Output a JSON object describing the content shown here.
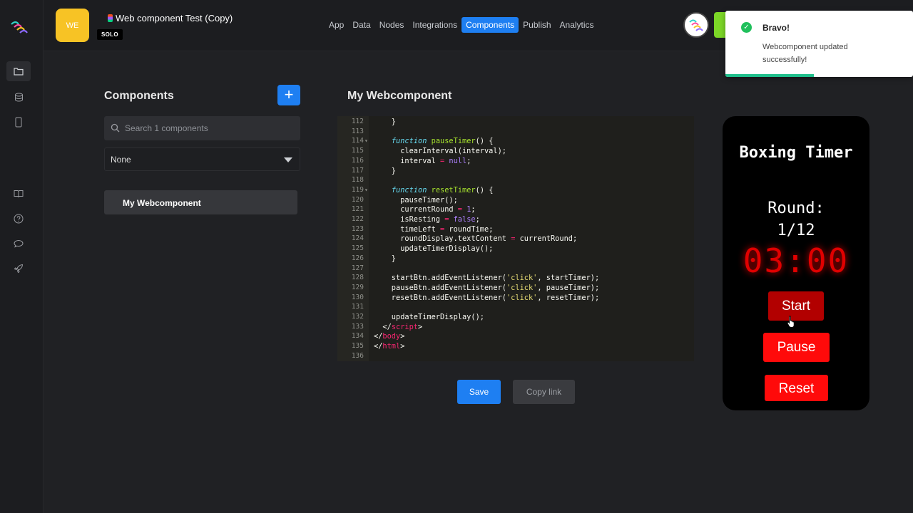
{
  "topbar": {
    "app_initials": "WE",
    "project_title": "Web component Test (Copy)",
    "badge": "SOLO",
    "nav": [
      {
        "label": "App"
      },
      {
        "label": "Data"
      },
      {
        "label": "Nodes"
      },
      {
        "label": "Integrations"
      },
      {
        "label": "Components",
        "active": true
      },
      {
        "label": "Publish"
      },
      {
        "label": "Analytics"
      }
    ]
  },
  "toast": {
    "title": "Bravo!",
    "message": "Webcomponent updated successfully!"
  },
  "components_panel": {
    "title": "Components",
    "add_label": "+",
    "search_placeholder": "Search 1 components",
    "filter_value": "None",
    "items": [
      "My Webcomponent"
    ]
  },
  "editor": {
    "title": "My Webcomponent",
    "lines": [
      {
        "n": "112",
        "fold": false,
        "html": "    }"
      },
      {
        "n": "113",
        "fold": false,
        "html": ""
      },
      {
        "n": "114",
        "fold": true,
        "html": "    <span class=\"kw\">function</span> <span class=\"fn\">pauseTimer</span>() {"
      },
      {
        "n": "115",
        "fold": false,
        "html": "      clearInterval(interval);"
      },
      {
        "n": "116",
        "fold": false,
        "html": "      interval <span class=\"op\">=</span> <span class=\"kv\">null</span>;"
      },
      {
        "n": "117",
        "fold": false,
        "html": "    }"
      },
      {
        "n": "118",
        "fold": false,
        "html": ""
      },
      {
        "n": "119",
        "fold": true,
        "html": "    <span class=\"kw\">function</span> <span class=\"fn\">resetTimer</span>() {"
      },
      {
        "n": "120",
        "fold": false,
        "html": "      pauseTimer();"
      },
      {
        "n": "121",
        "fold": false,
        "html": "      currentRound <span class=\"op\">=</span> <span class=\"num\">1</span>;"
      },
      {
        "n": "122",
        "fold": false,
        "html": "      isResting <span class=\"op\">=</span> <span class=\"kv\">false</span>;"
      },
      {
        "n": "123",
        "fold": false,
        "html": "      timeLeft <span class=\"op\">=</span> roundTime;"
      },
      {
        "n": "124",
        "fold": false,
        "html": "      roundDisplay.textContent <span class=\"op\">=</span> currentRound;"
      },
      {
        "n": "125",
        "fold": false,
        "html": "      updateTimerDisplay();"
      },
      {
        "n": "126",
        "fold": false,
        "html": "    }"
      },
      {
        "n": "127",
        "fold": false,
        "html": ""
      },
      {
        "n": "128",
        "fold": false,
        "html": "    startBtn.addEventListener(<span class=\"str\">'click'</span>, startTimer);"
      },
      {
        "n": "129",
        "fold": false,
        "html": "    pauseBtn.addEventListener(<span class=\"str\">'click'</span>, pauseTimer);"
      },
      {
        "n": "130",
        "fold": false,
        "html": "    resetBtn.addEventListener(<span class=\"str\">'click'</span>, resetTimer);"
      },
      {
        "n": "131",
        "fold": false,
        "html": ""
      },
      {
        "n": "132",
        "fold": false,
        "html": "    updateTimerDisplay();"
      },
      {
        "n": "133",
        "fold": false,
        "html": "  &lt;/<span class=\"tag\">script</span>&gt;"
      },
      {
        "n": "134",
        "fold": false,
        "html": "&lt;/<span class=\"tag\">body</span>&gt;"
      },
      {
        "n": "135",
        "fold": false,
        "html": "&lt;/<span class=\"tag\">html</span>&gt;"
      },
      {
        "n": "136",
        "fold": false,
        "html": ""
      }
    ]
  },
  "actions": {
    "save_label": "Save",
    "copy_link_label": "Copy link"
  },
  "preview": {
    "title": "Boxing Timer",
    "round_label": "Round:",
    "round_value": "1/12",
    "time": "03:00",
    "start_label": "Start",
    "pause_label": "Pause",
    "reset_label": "Reset"
  },
  "colors": {
    "accent": "#1e7ff2",
    "toast_success": "#20c05c",
    "timer_red": "#e00000",
    "avatar_yellow": "#f7c325"
  },
  "icons": [
    "logo-icon",
    "folder-icon",
    "database-icon",
    "mobile-icon",
    "book-icon",
    "help-icon",
    "chat-icon",
    "rocket-icon",
    "search-icon",
    "check-icon",
    "cursor-icon"
  ]
}
